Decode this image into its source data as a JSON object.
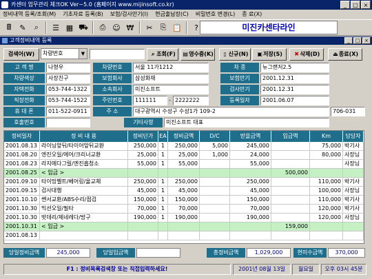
{
  "window": {
    "title": "카센터 업무관리 체크OK  Ver~5.0 (홈페이지 www.mijinsoft.co.kr)"
  },
  "menu": [
    "정비내역 등록/조회(M)",
    "기초자료 등록(B)",
    "보험/검사만기(I)",
    "현금출납장(C)",
    "비밀번호 변경(L)",
    "종 료(X)"
  ],
  "brand": "미진카센타라인",
  "subwindow": {
    "title": "고객정비내역 등록"
  },
  "search": {
    "button": "검색어(W)",
    "select_value": "차량번호",
    "query_value": ""
  },
  "actions": {
    "view": "조회(F)",
    "receipt": "영수증(K)",
    "new": "신규(N)",
    "save": "저장(S)",
    "delete": "삭제(D)",
    "exit": "종료(X)"
  },
  "form": {
    "customer_name": {
      "label": "고 객 명",
      "value": "나형우"
    },
    "car_color": {
      "label": "차량색상",
      "value": "사장친구"
    },
    "home_phone": {
      "label": "자택전화",
      "value": "053-744-1322"
    },
    "work_phone": {
      "label": "직장전화",
      "value": "053-744-1522"
    },
    "mobile": {
      "label": "휴 대 폰",
      "value": "011-522-0911"
    },
    "pager": {
      "label": "호출번호",
      "value": ""
    },
    "car_number": {
      "label": "차량번호",
      "value": "서울    11가1212"
    },
    "insurer": {
      "label": "보험회사",
      "value": "삼성화재"
    },
    "company": {
      "label": "소속회사",
      "value": "미진소프트"
    },
    "resident_no": {
      "label": "주민번호",
      "value_a": "111111",
      "value_b": "2222222"
    },
    "car_type": {
      "label": "차    종",
      "value": "뉴그랜저2.5"
    },
    "insurance_expiry": {
      "label": "보험만기",
      "value": "2001.12.31"
    },
    "inspection_expiry": {
      "label": "검사만기",
      "value": "2001.12.31"
    },
    "register_date": {
      "label": "등록일자",
      "value": "2001.06.07"
    },
    "address": {
      "label": "주    소",
      "value": "대구광역시 수성구 수성1가 109-2",
      "zip": "706-031"
    },
    "note": {
      "label": "기타사항",
      "value": "미진소프트 대표"
    }
  },
  "grid": {
    "columns": [
      "정비일자",
      "정 비 내 용",
      "정비단가",
      "EA",
      "정비금액",
      "D/C",
      "받을금액",
      "입금액",
      "Km",
      "담당자"
    ],
    "rows": [
      {
        "date": "2001.08.13",
        "desc": "라이닝앞뒤/타이어앞뒤교환",
        "unit": "250,000",
        "ea": "1",
        "amount": "250,000",
        "dc": "5,000",
        "due": "245,000",
        "paid": "",
        "km": "75,000",
        "staff": "박기사",
        "hl": false
      },
      {
        "date": "2001.08.20",
        "desc": "엔진오일/에어/크리너교환",
        "unit": "25,000",
        "ea": "1",
        "amount": "25,000",
        "dc": "1,000",
        "due": "24,000",
        "paid": "",
        "km": "80,000",
        "staff": "사장님",
        "hl": false
      },
      {
        "date": "2001.08.23",
        "desc": "라지에다그릴/엔진흡청소",
        "unit": "55,000",
        "ea": "1",
        "amount": "55,000",
        "dc": "",
        "due": "55,000",
        "paid": "",
        "km": "",
        "staff": "사장님",
        "hl": false
      },
      {
        "date": "2001.08.25",
        "desc": "< 입금 >",
        "unit": "",
        "ea": "",
        "amount": "",
        "dc": "",
        "due": "",
        "paid": "500,000",
        "km": "",
        "staff": "",
        "hl": true
      },
      {
        "date": "2001.09.10",
        "desc": "타이밍벨트/베어링/울교체",
        "unit": "250,000",
        "ea": "1",
        "amount": "250,000",
        "dc": "",
        "due": "250,000",
        "paid": "",
        "km": "110,000",
        "staff": "박기사",
        "hl": false
      },
      {
        "date": "2001.09.15",
        "desc": "검사대행",
        "unit": "45,000",
        "ea": "1",
        "amount": "45,000",
        "dc": "",
        "due": "45,000",
        "paid": "",
        "km": "100,000",
        "staff": "사장님",
        "hl": false
      },
      {
        "date": "2001.10.10",
        "desc": "쎈서교환/ABS수리/점검",
        "unit": "150,000",
        "ea": "1",
        "amount": "150,000",
        "dc": "",
        "due": "150,000",
        "paid": "",
        "km": "110,000",
        "staff": "박기사",
        "hl": false
      },
      {
        "date": "2001.10.30",
        "desc": "믹션오일/필타",
        "unit": "70,000",
        "ea": "1",
        "amount": "70,000",
        "dc": "",
        "due": "70,000",
        "paid": "",
        "km": "120,000",
        "staff": "박기사",
        "hl": false
      },
      {
        "date": "2001.10.30",
        "desc": "밧데리/제네레다/방구",
        "unit": "190,000",
        "ea": "1",
        "amount": "190,000",
        "dc": "",
        "due": "190,000",
        "paid": "",
        "km": "120,000",
        "staff": "사장님",
        "hl": false
      },
      {
        "date": "2001.10.31",
        "desc": "< 입금 >",
        "unit": "",
        "ea": "",
        "amount": "",
        "dc": "",
        "due": "",
        "paid": "159,000",
        "km": "",
        "staff": "",
        "hl": true
      },
      {
        "date": "2001.08.13",
        "desc": "",
        "unit": "",
        "ea": "",
        "amount": "",
        "dc": "",
        "due": "",
        "paid": "",
        "km": "",
        "staff": "",
        "hl": false
      }
    ]
  },
  "totals": {
    "day_repair_label": "당일정비금액",
    "day_repair_value": "245,000",
    "day_paid_label": "당일입금액",
    "day_paid_value": "",
    "total_label": "총정비금액",
    "total_value": "1,029,000",
    "unpaid_label": "현미수금액",
    "unpaid_value": "370,000"
  },
  "status": {
    "hint": "F1 : 정비목록검색창 또는 직접입력하세요!",
    "date": "2001년 08월 13일",
    "weekday": "월요일",
    "time": "오후 03시 45분"
  }
}
